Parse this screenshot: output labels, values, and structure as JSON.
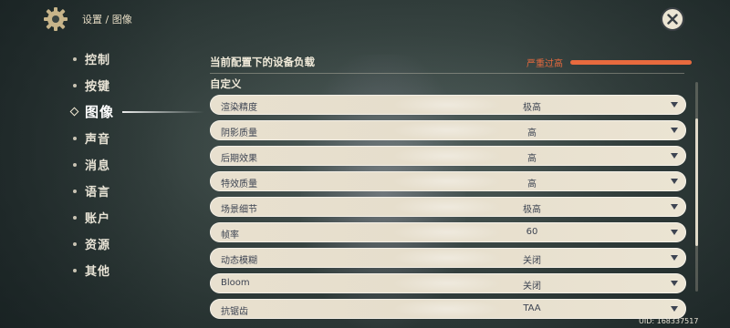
{
  "breadcrumb": {
    "parent": "设置",
    "separator": "/",
    "current": "图像"
  },
  "sidebar": {
    "items": [
      {
        "label": "控制"
      },
      {
        "label": "按键"
      },
      {
        "label": "图像"
      },
      {
        "label": "声音"
      },
      {
        "label": "消息"
      },
      {
        "label": "语言"
      },
      {
        "label": "账户"
      },
      {
        "label": "资源"
      },
      {
        "label": "其他"
      }
    ],
    "active_index": 2
  },
  "device_load": {
    "label": "当前配置下的设备负载",
    "status": "严重过高",
    "level_fraction": 1.0,
    "color": "#e86a3e"
  },
  "section": {
    "title": "自定义"
  },
  "settings": [
    {
      "name": "渲染精度",
      "value": "极高"
    },
    {
      "name": "阴影质量",
      "value": "高"
    },
    {
      "name": "后期效果",
      "value": "高"
    },
    {
      "name": "特效质量",
      "value": "高"
    },
    {
      "name": "场景细节",
      "value": "极高"
    },
    {
      "name": "帧率",
      "value": "60"
    },
    {
      "name": "动态模糊",
      "value": "关闭"
    },
    {
      "name": "Bloom",
      "value": "关闭"
    },
    {
      "name": "抗锯齿",
      "value": "TAA"
    }
  ],
  "uid": "UID: 168337517",
  "icons": {
    "settings": "gear-icon",
    "close": "close-icon",
    "dropdown": "chevron-down-icon"
  }
}
